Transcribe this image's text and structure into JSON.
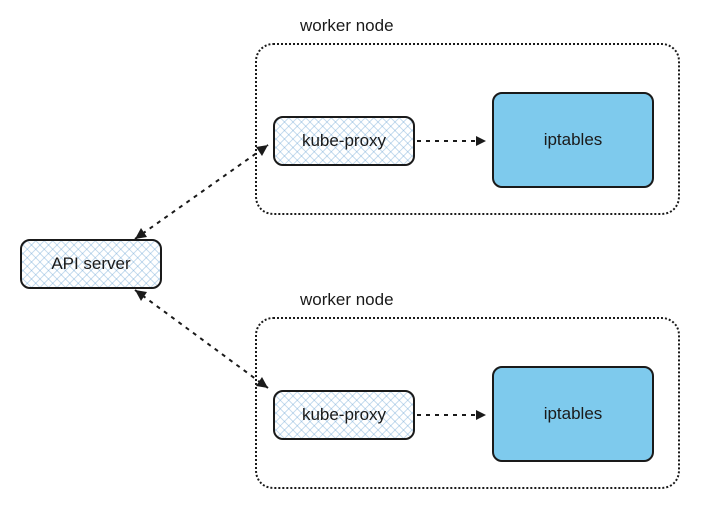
{
  "api_server": {
    "label": "API server"
  },
  "worker_nodes": {
    "top": {
      "title": "worker node",
      "kube_proxy": "kube-proxy",
      "iptables": "iptables"
    },
    "bottom": {
      "title": "worker node",
      "kube_proxy": "kube-proxy",
      "iptables": "iptables"
    }
  }
}
